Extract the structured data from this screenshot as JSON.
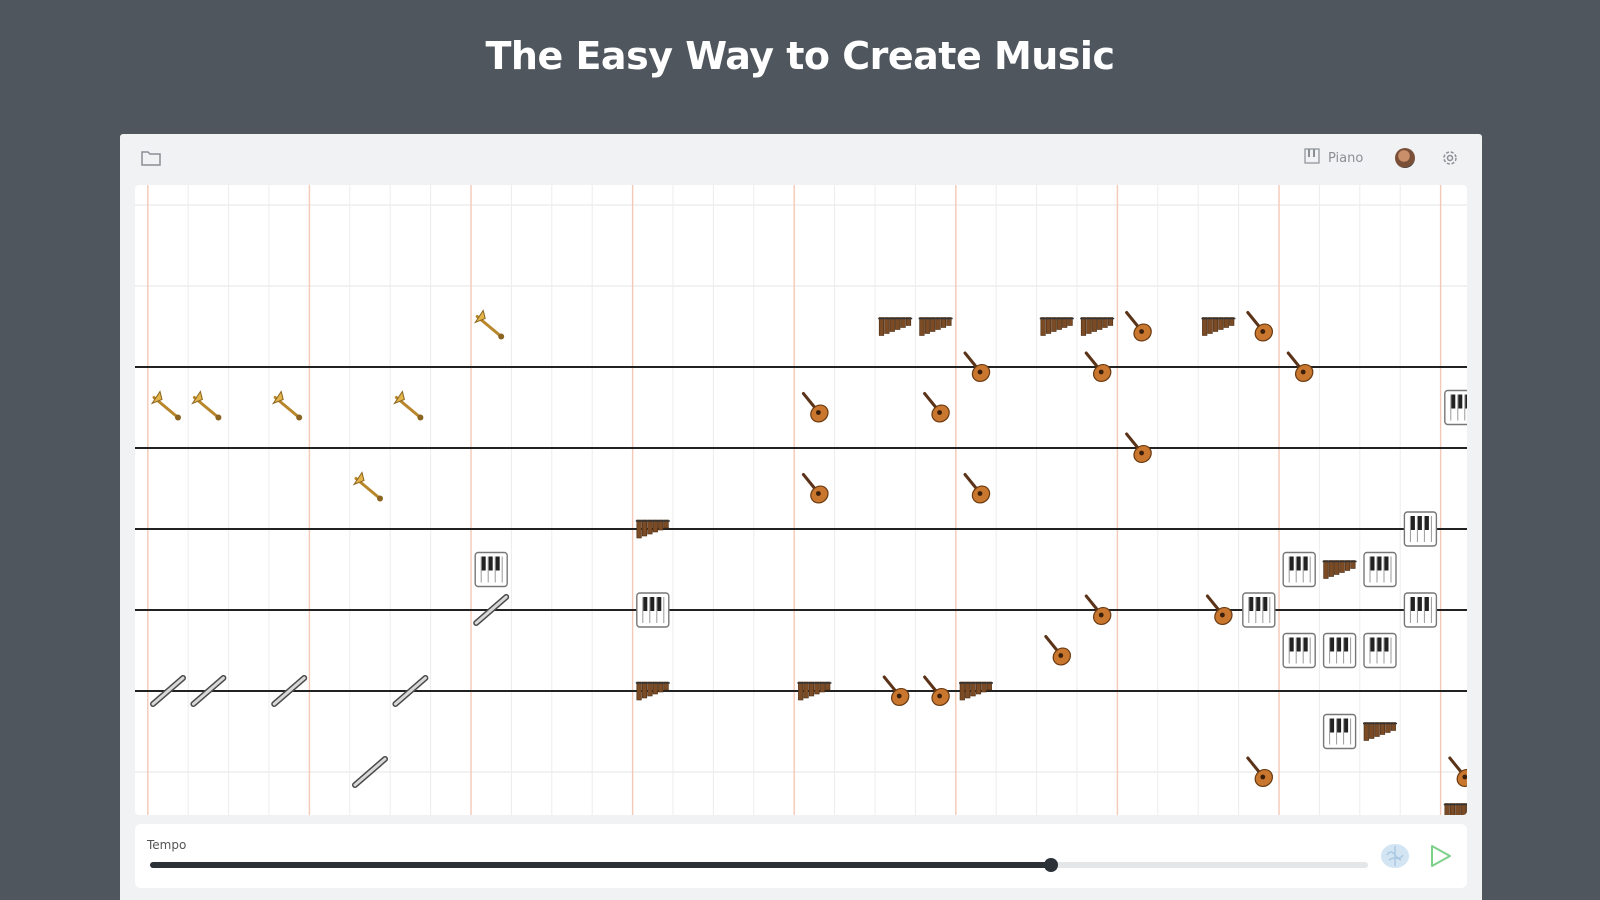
{
  "headline": "The Easy Way to Create Music",
  "toolbar": {
    "folder_icon": "folder-icon",
    "instrument_label": "Piano",
    "instrument_icon": "piano-icon",
    "avatar": "user-avatar",
    "settings_icon": "gear-icon"
  },
  "footer": {
    "tempo_label": "Tempo",
    "tempo_level": 0.74,
    "ai_icon": "brain-icon",
    "play_icon": "play-icon"
  },
  "colors": {
    "background": "#4f565d",
    "accent_lines": "#f5c8b5",
    "staff_lines": "#222222",
    "slider": "#2b3137"
  },
  "score": {
    "columns": 33,
    "measure_every": 4,
    "rows": 16,
    "staff_rows": [
      4,
      6,
      8,
      10,
      12
    ],
    "notes": [
      {
        "instrument": "trumpet",
        "col": 0,
        "row": 5
      },
      {
        "instrument": "trumpet",
        "col": 1,
        "row": 5
      },
      {
        "instrument": "trumpet",
        "col": 3,
        "row": 5
      },
      {
        "instrument": "trumpet",
        "col": 6,
        "row": 5
      },
      {
        "instrument": "trumpet",
        "col": 5,
        "row": 7
      },
      {
        "instrument": "trumpet",
        "col": 8,
        "row": 3
      },
      {
        "instrument": "flute",
        "col": 0,
        "row": 12
      },
      {
        "instrument": "flute",
        "col": 1,
        "row": 12
      },
      {
        "instrument": "flute",
        "col": 3,
        "row": 12
      },
      {
        "instrument": "flute",
        "col": 6,
        "row": 12
      },
      {
        "instrument": "flute",
        "col": 5,
        "row": 14
      },
      {
        "instrument": "flute",
        "col": 8,
        "row": 10
      },
      {
        "instrument": "piano",
        "col": 8,
        "row": 9
      },
      {
        "instrument": "piano",
        "col": 12,
        "row": 10
      },
      {
        "instrument": "marimba",
        "col": 12,
        "row": 8
      },
      {
        "instrument": "marimba",
        "col": 12,
        "row": 12
      },
      {
        "instrument": "marimba",
        "col": 16,
        "row": 12
      },
      {
        "instrument": "guitar",
        "col": 16,
        "row": 5
      },
      {
        "instrument": "guitar",
        "col": 16,
        "row": 7
      },
      {
        "instrument": "guitar",
        "col": 18,
        "row": 12
      },
      {
        "instrument": "marimba",
        "col": 18,
        "row": 3
      },
      {
        "instrument": "marimba",
        "col": 19,
        "row": 3
      },
      {
        "instrument": "guitar",
        "col": 19,
        "row": 5
      },
      {
        "instrument": "guitar",
        "col": 19,
        "row": 12
      },
      {
        "instrument": "marimba",
        "col": 20,
        "row": 12
      },
      {
        "instrument": "guitar",
        "col": 20,
        "row": 4
      },
      {
        "instrument": "guitar",
        "col": 20,
        "row": 7
      },
      {
        "instrument": "marimba",
        "col": 22,
        "row": 3
      },
      {
        "instrument": "guitar",
        "col": 22,
        "row": 11
      },
      {
        "instrument": "marimba",
        "col": 23,
        "row": 3
      },
      {
        "instrument": "guitar",
        "col": 23,
        "row": 4
      },
      {
        "instrument": "guitar",
        "col": 23,
        "row": 10
      },
      {
        "instrument": "guitar",
        "col": 24,
        "row": 3
      },
      {
        "instrument": "guitar",
        "col": 24,
        "row": 6
      },
      {
        "instrument": "marimba",
        "col": 26,
        "row": 3
      },
      {
        "instrument": "guitar",
        "col": 26,
        "row": 10
      },
      {
        "instrument": "guitar",
        "col": 27,
        "row": 3
      },
      {
        "instrument": "piano",
        "col": 27,
        "row": 10
      },
      {
        "instrument": "guitar",
        "col": 27,
        "row": 14
      },
      {
        "instrument": "guitar",
        "col": 28,
        "row": 4
      },
      {
        "instrument": "piano",
        "col": 28,
        "row": 9
      },
      {
        "instrument": "piano",
        "col": 28,
        "row": 11
      },
      {
        "instrument": "marimba",
        "col": 29,
        "row": 9
      },
      {
        "instrument": "piano",
        "col": 29,
        "row": 11
      },
      {
        "instrument": "piano",
        "col": 29,
        "row": 13
      },
      {
        "instrument": "marimba",
        "col": 30,
        "row": 13
      },
      {
        "instrument": "piano",
        "col": 30,
        "row": 9
      },
      {
        "instrument": "piano",
        "col": 30,
        "row": 11
      },
      {
        "instrument": "piano",
        "col": 31,
        "row": 8
      },
      {
        "instrument": "piano",
        "col": 31,
        "row": 10
      },
      {
        "instrument": "piano",
        "col": 32,
        "row": 5
      },
      {
        "instrument": "guitar",
        "col": 32,
        "row": 14
      },
      {
        "instrument": "marimba",
        "col": 32,
        "row": 15
      }
    ]
  }
}
